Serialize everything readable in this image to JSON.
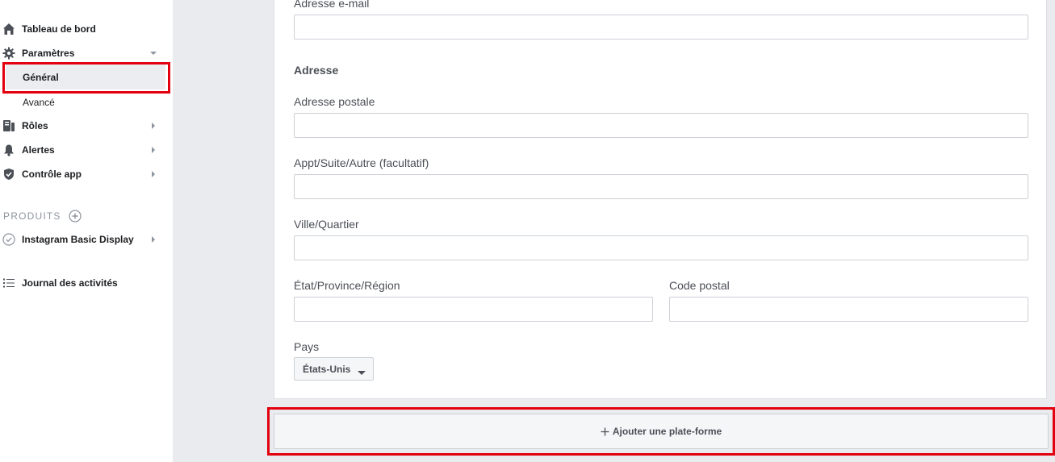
{
  "sidebar": {
    "dashboard": {
      "label": "Tableau de bord",
      "icon": "home-icon"
    },
    "settings": {
      "label": "Paramètres",
      "icon": "gear-icon",
      "expanded": true
    },
    "settings_general": {
      "label": "Général",
      "selected": true
    },
    "settings_advanced": {
      "label": "Avancé"
    },
    "roles": {
      "label": "Rôles",
      "icon": "roles-icon"
    },
    "alerts": {
      "label": "Alertes",
      "icon": "bell-icon"
    },
    "app_review": {
      "label": "Contrôle app",
      "icon": "shield-icon"
    },
    "products_header": "PRODUITS",
    "instagram": {
      "label": "Instagram Basic Display",
      "icon": "check-circle-icon"
    },
    "activity_log": {
      "label": "Journal des activités",
      "icon": "list-icon"
    }
  },
  "form": {
    "email_label": "Adresse e-mail",
    "email_value": "",
    "address_section": "Adresse",
    "street_label": "Adresse postale",
    "street_value": "",
    "apt_label": "Appt/Suite/Autre (facultatif)",
    "apt_value": "",
    "city_label": "Ville/Quartier",
    "city_value": "",
    "state_label": "État/Province/Région",
    "state_value": "",
    "zip_label": "Code postal",
    "zip_value": "",
    "country_label": "Pays",
    "country_value": "États-Unis"
  },
  "add_platform_label": "Ajouter une plate-forme",
  "colors": {
    "highlight": "#e3000f",
    "background_gray": "#e9ebee",
    "selected_bg": "#ebedf0",
    "text_primary": "#1c1e21",
    "text_secondary": "#4b4f56"
  }
}
